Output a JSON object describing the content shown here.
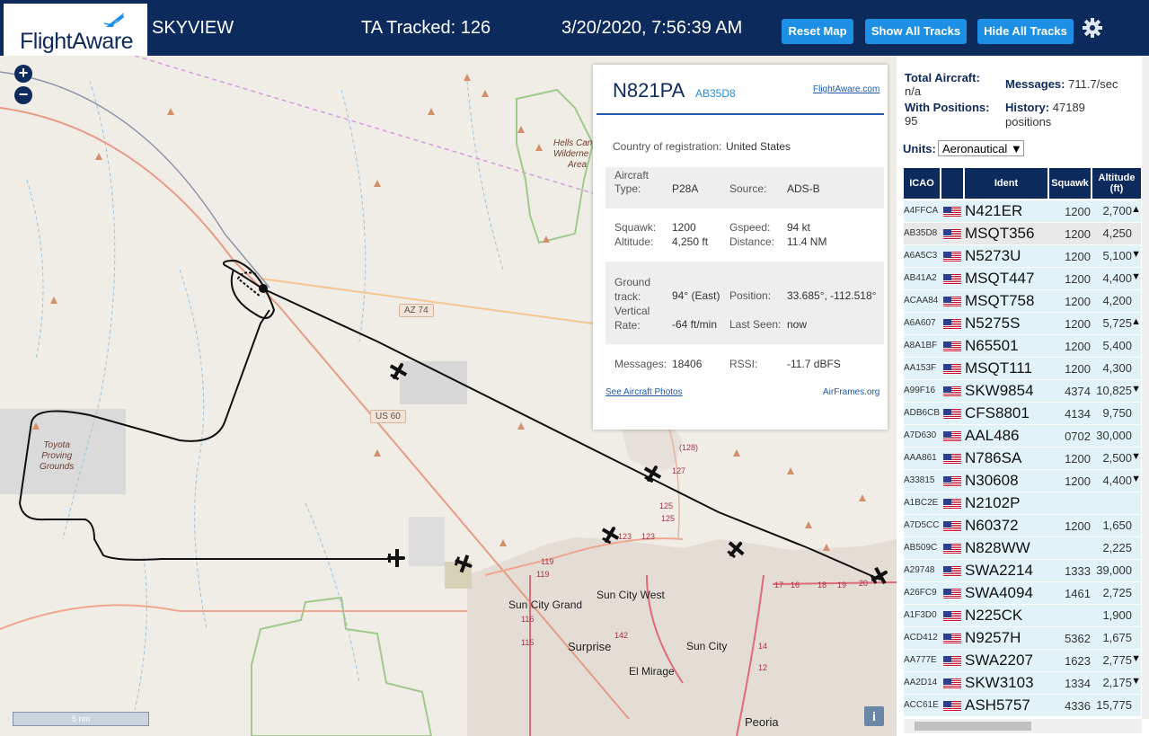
{
  "header": {
    "logo": "FlightAware",
    "app_title": "SKYVIEW",
    "tracked": "TA Tracked: 126",
    "datetime": "3/20/2020, 7:56:39 AM",
    "buttons": {
      "reset": "Reset Map",
      "show": "Show All Tracks",
      "hide": "Hide All Tracks"
    }
  },
  "map": {
    "zoom_in": "+",
    "zoom_out": "−",
    "scale_label": "5 nm",
    "info": "i",
    "labels": {
      "hells_canyon": [
        "Hells Canyo",
        "Wilderne",
        "Area"
      ],
      "toyota": [
        "Toyota",
        "Proving",
        "Grounds"
      ],
      "az74": "AZ 74",
      "us60": "US 60",
      "sun_city_grand": "Sun City Grand",
      "sun_city_west": "Sun City West",
      "surprise": "Surprise",
      "sun_city": "Sun City",
      "el_mirage": "El Mirage",
      "peoria": "Peoria",
      "r119": "119",
      "r116": "116",
      "r115": "115",
      "r142": "142",
      "r123a": "123",
      "r123b": "123",
      "r125a": "125",
      "r125b": "125",
      "r127": "127",
      "r128": "(128)",
      "r17": "17",
      "r16": "16",
      "r18": "18",
      "r19": "19",
      "r20": "20",
      "r14": "14",
      "r12": "12"
    }
  },
  "popup": {
    "ident": "N821PA",
    "icao": "AB35D8",
    "fa_link": "FlightAware.com",
    "country_label": "Country of registration:",
    "country": "United States",
    "aircraft_type_label": [
      "Aircraft",
      "Type:"
    ],
    "aircraft_type": "P28A",
    "source_label": "Source:",
    "source": "ADS-B",
    "squawk_label": "Squawk:",
    "squawk": "1200",
    "gspeed_label": "Gspeed:",
    "gspeed": "94 kt",
    "altitude_label": "Altitude:",
    "altitude": "4,250 ft",
    "distance_label": "Distance:",
    "distance": "11.4 NM",
    "ground_track_label": [
      "Ground",
      "track:"
    ],
    "ground_track": "94° (East)",
    "position_label": "Position:",
    "position": "33.685°, -112.518°",
    "vrate_label": [
      "Vertical",
      "Rate:"
    ],
    "vrate": "-64 ft/min",
    "lastseen_label": "Last Seen:",
    "lastseen": "now",
    "messages_label": "Messages:",
    "messages": "18406",
    "rssi_label": "RSSI:",
    "rssi": "-11.7 dBFS",
    "photos_link": "See Aircraft Photos",
    "airframes_link": "AirFrames.org"
  },
  "sidebar": {
    "total_aircraft_label": "Total Aircraft:",
    "total_aircraft": "n/a",
    "messages_label": "Messages:",
    "messages": "711.7/sec",
    "with_positions_label": "With Positions:",
    "with_positions": "95",
    "history_label": "History:",
    "history": "47189",
    "history_unit": "positions",
    "units_label": "Units:",
    "units_value": "Aeronautical ▼",
    "columns": {
      "icao": "ICAO",
      "ident": "Ident",
      "squawk": "Squawk",
      "altitude": [
        "Altitude",
        "(ft)"
      ]
    },
    "rows": [
      {
        "icao": "A4FFCA",
        "ident": "N421ER",
        "squawk": "1200",
        "alt": "2,700",
        "arrow": "▲"
      },
      {
        "icao": "AB35D8",
        "ident": "MSQT356",
        "squawk": "1200",
        "alt": "4,250",
        "arrow": ""
      },
      {
        "icao": "A6A5C3",
        "ident": "N5273U",
        "squawk": "1200",
        "alt": "5,100",
        "arrow": "▼"
      },
      {
        "icao": "AB41A2",
        "ident": "MSQT447",
        "squawk": "1200",
        "alt": "4,400",
        "arrow": "▼"
      },
      {
        "icao": "ACAA84",
        "ident": "MSQT758",
        "squawk": "1200",
        "alt": "4,200",
        "arrow": ""
      },
      {
        "icao": "A6A607",
        "ident": "N5275S",
        "squawk": "1200",
        "alt": "5,725",
        "arrow": "▲"
      },
      {
        "icao": "A8A1BF",
        "ident": "N65501",
        "squawk": "1200",
        "alt": "5,400",
        "arrow": ""
      },
      {
        "icao": "AA153F",
        "ident": "MSQT111",
        "squawk": "1200",
        "alt": "4,300",
        "arrow": ""
      },
      {
        "icao": "A99F16",
        "ident": "SKW9854",
        "squawk": "4374",
        "alt": "10,825",
        "arrow": "▼"
      },
      {
        "icao": "ADB6CB",
        "ident": "CFS8801",
        "squawk": "4134",
        "alt": "9,750",
        "arrow": ""
      },
      {
        "icao": "A7D630",
        "ident": "AAL486",
        "squawk": "0702",
        "alt": "30,000",
        "arrow": ""
      },
      {
        "icao": "AAA861",
        "ident": "N786SA",
        "squawk": "1200",
        "alt": "2,500",
        "arrow": "▼"
      },
      {
        "icao": "A33815",
        "ident": "N30608",
        "squawk": "1200",
        "alt": "4,400",
        "arrow": "▼"
      },
      {
        "icao": "A1BC2E",
        "ident": "N2102P",
        "squawk": "",
        "alt": "",
        "arrow": ""
      },
      {
        "icao": "A7D5CC",
        "ident": "N60372",
        "squawk": "1200",
        "alt": "1,650",
        "arrow": ""
      },
      {
        "icao": "AB509C",
        "ident": "N828WW",
        "squawk": "",
        "alt": "2,225",
        "arrow": ""
      },
      {
        "icao": "A29748",
        "ident": "SWA2214",
        "squawk": "1333",
        "alt": "39,000",
        "arrow": ""
      },
      {
        "icao": "A26FC9",
        "ident": "SWA4094",
        "squawk": "1461",
        "alt": "2,725",
        "arrow": ""
      },
      {
        "icao": "A1F3D0",
        "ident": "N225CK",
        "squawk": "",
        "alt": "1,900",
        "arrow": ""
      },
      {
        "icao": "ACD412",
        "ident": "N9257H",
        "squawk": "5362",
        "alt": "1,675",
        "arrow": ""
      },
      {
        "icao": "AA777E",
        "ident": "SWA2207",
        "squawk": "1623",
        "alt": "2,775",
        "arrow": "▼"
      },
      {
        "icao": "AA2D14",
        "ident": "SKW3103",
        "squawk": "1334",
        "alt": "2,175",
        "arrow": "▼"
      },
      {
        "icao": "ACC61E",
        "ident": "ASH5757",
        "squawk": "4336",
        "alt": "15,775",
        "arrow": ""
      }
    ]
  },
  "colors": {
    "header_bg": "#0d2a5c",
    "button_bg": "#1d8fe4",
    "row_bg": "#e1f3f9",
    "selected_row_bg": "#e8e8e8"
  }
}
